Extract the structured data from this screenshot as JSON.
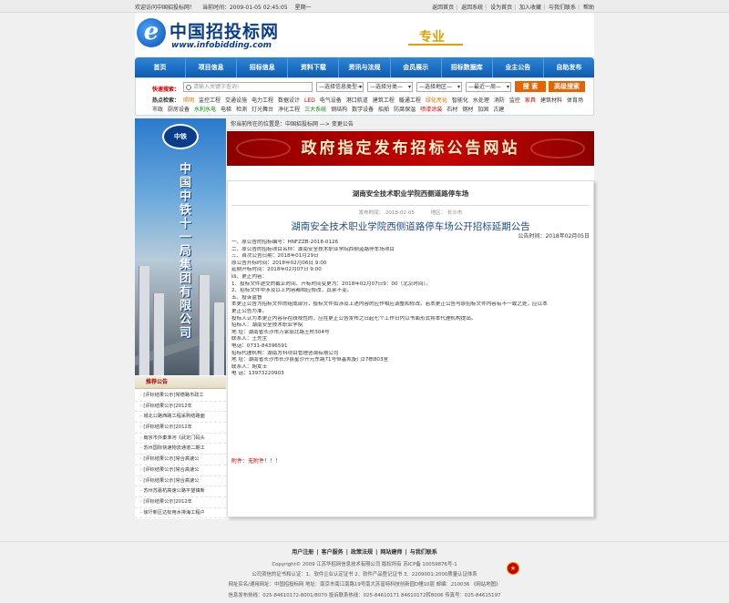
{
  "topbar": {
    "welcome": "欢迎访问中国招投标网！",
    "time_label": "当前时间：2009-01-05 02:45:05",
    "weekday": "星期一",
    "links": [
      "返回首页",
      "返回系统",
      "设为首页",
      "加入收藏",
      "与我们联系",
      "帮助"
    ]
  },
  "header": {
    "logo_letter": "e",
    "logo_cn": "中国招投标网",
    "logo_url": "www.infobidding.com",
    "slogan": "专业"
  },
  "nav": {
    "items": [
      "首页",
      "项目信息",
      "招标信息",
      "资料下载",
      "资讯与法规",
      "会员展示",
      "招标数据库",
      "业主公告",
      "自助发布"
    ]
  },
  "search": {
    "label": "快速搜索：",
    "placeholder": "请输入关键字查询!",
    "select1": "—选择信息类型—",
    "select2": "—选择分类—",
    "select3": "—选择地区—",
    "select4": "—最近一周—",
    "search_label": "搜 索",
    "advanced_label": "高级搜索",
    "hot_label": "热点检索：",
    "hot_items": [
      {
        "t": "照明",
        "c": "org"
      },
      {
        "t": "监控工程",
        "c": ""
      },
      {
        "t": "交通设施",
        "c": ""
      },
      {
        "t": "电力工程",
        "c": ""
      },
      {
        "t": "数据设计",
        "c": ""
      },
      {
        "t": "LED",
        "c": "red"
      },
      {
        "t": "电气设备",
        "c": ""
      },
      {
        "t": "港口航道",
        "c": ""
      },
      {
        "t": "建筑工程",
        "c": ""
      },
      {
        "t": "暖通工程",
        "c": ""
      },
      {
        "t": "绿化亮化",
        "c": "org"
      },
      {
        "t": "智能化",
        "c": ""
      },
      {
        "t": "水处理",
        "c": ""
      },
      {
        "t": "消防",
        "c": ""
      },
      {
        "t": "监控",
        "c": ""
      },
      {
        "t": "家具",
        "c": "red"
      },
      {
        "t": "建筑材料",
        "c": ""
      },
      {
        "t": "体育场",
        "c": ""
      },
      {
        "t": "市政",
        "c": ""
      },
      {
        "t": "厨房设备",
        "c": ""
      },
      {
        "t": "水利水电",
        "c": "grn"
      },
      {
        "t": "电梯",
        "c": ""
      },
      {
        "t": "检测",
        "c": ""
      },
      {
        "t": "灯光舞台",
        "c": ""
      },
      {
        "t": "净化工程",
        "c": ""
      },
      {
        "t": "三大系统",
        "c": "grn"
      },
      {
        "t": "钢结构",
        "c": ""
      },
      {
        "t": "数学设备",
        "c": ""
      },
      {
        "t": "船舶",
        "c": ""
      },
      {
        "t": "防腐保温",
        "c": ""
      },
      {
        "t": "喷漆涂装",
        "c": "red"
      },
      {
        "t": "石材",
        "c": ""
      },
      {
        "t": "钢材",
        "c": ""
      },
      {
        "t": "加固",
        "c": ""
      },
      {
        "t": "古建",
        "c": ""
      }
    ]
  },
  "left": {
    "banner_logo": "中铁",
    "banner_text": "中国中铁十一局集团有限公司",
    "rec_title": "推荐公告",
    "rec_items": [
      "[评标结果公示]常德路市政工",
      "[评标结果公示]2012年",
      "城北公路西路工程采购结路面",
      "[评标结果公示]2012年",
      "南京市外秦淮河《武定门码头",
      "苏州国际快速物流通道二期工",
      "[评标结果公示]常合高速公",
      "[评标结果公示]常合高速公",
      "[评标结果公示]常合高速公",
      "苏州苏嘉杭高速公路平望镇新",
      "[评标结果公示]2012年",
      "徐圩新区达标用水排海工程户"
    ]
  },
  "main": {
    "breadcrumb": "你当前所在的位置是：中国招投标网 —> 变更公告",
    "gov_banner": "政府指定发布招标公告网站",
    "title": "湖南安全技术职业学院西侧道路停车场",
    "publish_time": "发布时间： 2018-02-05",
    "region": "地区： 长沙市",
    "big_title": "湖南安全技术职业学院西侧道路停车场公开招标延期公告",
    "date": "公告时间：2018年02月05日",
    "body": [
      "一、原公告的招标编号：HNFZZB-2018-0126",
      "二、原公告的招标项目名称：湖南安全技术职业学院西侧道路停车场项目",
      "三、首次公告日期：2018年01月29日",
      "   原公告开标时间：2018年02月06日 9:00",
      "   延期开标时间：2018年02月07日 9:00",
      "四、更正内容：",
      "1、投标文件递交的截止时间、开标时间变更为：2018年02月07日9：00（北京时间）。",
      "2、招标文件中涉及以上内容都相应修改，其余不变。",
      "五、投诉监督",
      "   本更正公告为招标文件的组成部分，投标文件如涉及上述内容的应作相应调整和修改。若本更正公告与原招标文件内容有不一致之处，应以本",
      "更正公告为准。",
      "   投标人认为本更正内容存在歧视性的，应在更正公告发布之日起七个工作日内以书面形式将本代理机构提出。",
      "   招标人：湖南安全技术职业学院",
      "地 址：湖南省长沙市万家丽北路土桥304号",
      "联系人：王先生",
      "  电话：0731-84396591",
      "   招标代理机构：湖南方科项目管理咨询有限公司",
      "地 址：湖南省长沙市长沙县星沙开元东路71号恒基凯旋门27栋803室",
      "联系人：胡女士",
      "电 话：13973220903"
    ],
    "attach_label": "附件：",
    "attach_value": "无附件！！！"
  },
  "footer": {
    "links": [
      "用户注册",
      "客户服务",
      "政策法规",
      "网站建师",
      "与我们联系"
    ],
    "line1": "Copyright© 2009 江苏华招网信息技术有限公司 版权所有 苏ICP备 10059876号-1",
    "line2": "公司资信的证书和认证：1、软件企业认定证书 2、软件产品登记证书 3、2209001:2000质量认证体系",
    "line3": "网址实名/通用网址：中国招投标网 地址：南京市南江南路19号南大苏富特科技创新园D幢10层 邮编：210036 《网站地图》",
    "line4": "信息发布热线：025-84610172-8001/8070 投诉联系热线：025-84610171 84610172转8006 传真号：025-84615197"
  }
}
